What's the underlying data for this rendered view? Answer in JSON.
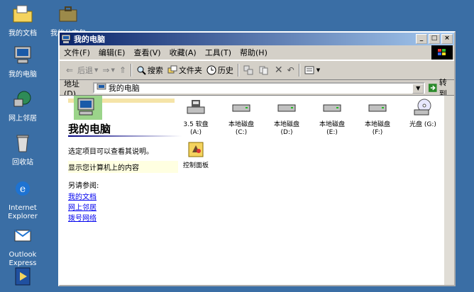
{
  "desktop": {
    "icons": [
      {
        "label": "我的文档"
      },
      {
        "label": "我的公文包"
      },
      {
        "label": "我的电脑"
      },
      {
        "label": "网上邻居"
      },
      {
        "label": "回收站"
      },
      {
        "label": "Internet Explorer"
      },
      {
        "label": "Outlook Express"
      }
    ]
  },
  "window": {
    "title": "我的电脑",
    "controls": {
      "minimize": "_",
      "maximize": "□",
      "close": "×"
    },
    "menu": [
      "文件(F)",
      "编辑(E)",
      "查看(V)",
      "收藏(A)",
      "工具(T)",
      "帮助(H)"
    ],
    "toolbar": {
      "back": "后退",
      "search": "搜索",
      "folders": "文件夹",
      "history": "历史"
    },
    "address": {
      "label": "地址(D)",
      "value": "我的电脑",
      "go": "转到"
    },
    "left_pane": {
      "title": "我的电脑",
      "description": "选定项目可以查看其说明。",
      "hint": "显示您计算机上的内容",
      "see_also": "另请参阅:",
      "links": [
        "我的文档",
        "网上邻居",
        "拨号网络"
      ]
    },
    "drives": [
      {
        "line1": "3.5 软盘",
        "line2": "(A:)"
      },
      {
        "line1": "本地磁盘",
        "line2": "(C:)"
      },
      {
        "line1": "本地磁盘",
        "line2": "(D:)"
      },
      {
        "line1": "本地磁盘",
        "line2": "(E:)"
      },
      {
        "line1": "本地磁盘",
        "line2": "(F:)"
      },
      {
        "line1": "光盘 (G:)",
        "line2": ""
      },
      {
        "line1": "控制面板",
        "line2": ""
      }
    ]
  }
}
